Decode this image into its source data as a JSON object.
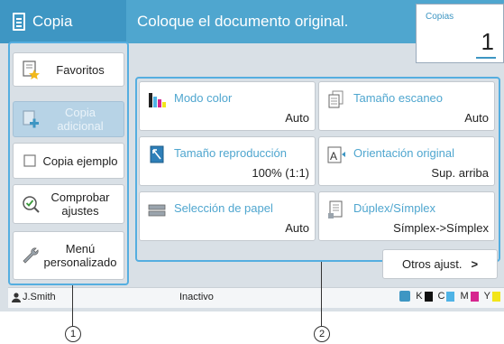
{
  "app": {
    "title": "Copia",
    "message": "Coloque el documento original."
  },
  "copies": {
    "label": "Copias",
    "value": "1"
  },
  "left_buttons": [
    {
      "label": "Favoritos",
      "icon": "star-document-icon",
      "enabled": true
    },
    {
      "label": "Copia adicional",
      "icon": "add-copy-icon",
      "enabled": false
    },
    {
      "label": "Copia ejemplo",
      "icon": "checkbox-icon",
      "enabled": true
    },
    {
      "label": "Comprobar ajustes",
      "icon": "check-magnifier-icon",
      "enabled": true
    },
    {
      "label": "Menú personalizado",
      "icon": "wrench-icon",
      "enabled": true
    }
  ],
  "tiles": [
    {
      "name": "Modo color",
      "value": "Auto"
    },
    {
      "name": "Tamaño escaneo",
      "value": "Auto"
    },
    {
      "name": "Tamaño reproducción",
      "value": "100% (1:1)"
    },
    {
      "name": "Orientación original",
      "value": "Sup. arriba"
    },
    {
      "name": "Selección de papel",
      "value": "Auto"
    },
    {
      "name": "Dúplex/Símplex",
      "value": "Símplex->Símplex"
    }
  ],
  "more_button": {
    "label": "Otros ajust.",
    "chevron": ">"
  },
  "status": {
    "user": "J.Smith",
    "state": "Inactivo",
    "inks": [
      {
        "letter": "K",
        "color": "#111111"
      },
      {
        "letter": "C",
        "color": "#4fb3e6"
      },
      {
        "letter": "M",
        "color": "#d6268f"
      },
      {
        "letter": "Y",
        "color": "#f2e51a"
      }
    ]
  },
  "callouts": [
    "1",
    "2"
  ]
}
